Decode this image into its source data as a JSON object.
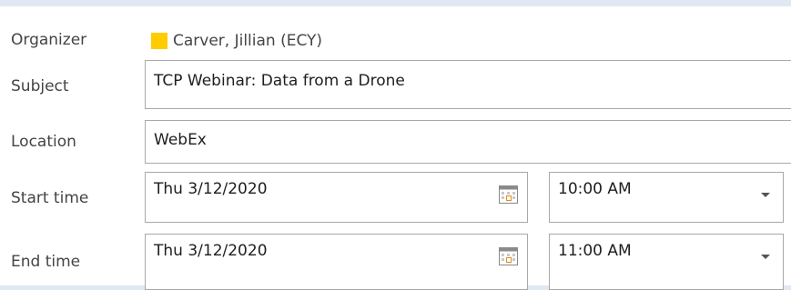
{
  "organizer": {
    "label": "Organizer",
    "name": "Carver, Jillian (ECY)",
    "presence_color": "#ffcc00"
  },
  "subject": {
    "label": "Subject",
    "value": "TCP Webinar: Data from a Drone"
  },
  "location": {
    "label": "Location",
    "value": "WebEx"
  },
  "start": {
    "label": "Start time",
    "date": "Thu 3/12/2020",
    "time": "10:00 AM"
  },
  "end": {
    "label": "End time",
    "date": "Thu 3/12/2020",
    "time": "11:00 AM"
  },
  "icons": {
    "calendar": "calendar-icon",
    "dropdown": "chevron-down-icon"
  }
}
